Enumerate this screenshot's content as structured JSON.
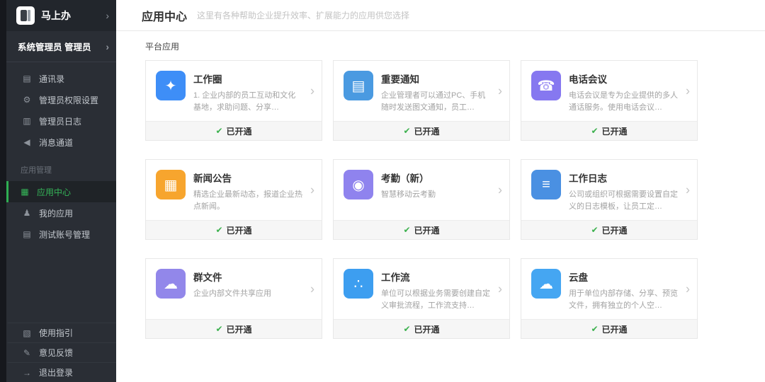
{
  "icons": {
    "chevron": "›",
    "check": "✔"
  },
  "sidebar": {
    "logo_text": "马上办",
    "admin_label": "系统管理员 管理员",
    "menu": [
      {
        "label": "通讯录",
        "glyph": "▤"
      },
      {
        "label": "管理员权限设置",
        "glyph": "⚙"
      },
      {
        "label": "管理员日志",
        "glyph": "▥"
      },
      {
        "label": "消息通道",
        "glyph": "◀"
      }
    ],
    "section_label": "应用管理",
    "app_menu": [
      {
        "label": "应用中心",
        "glyph": "▦"
      },
      {
        "label": "我的应用",
        "glyph": "♟"
      },
      {
        "label": "测试账号管理",
        "glyph": "▤"
      }
    ],
    "footer_menu": [
      {
        "label": "使用指引",
        "glyph": "▧"
      },
      {
        "label": "意见反馈",
        "glyph": "✎"
      },
      {
        "label": "退出登录",
        "glyph": "→"
      }
    ]
  },
  "header": {
    "title": "应用中心",
    "subtitle": "这里有各种帮助企业提升效率、扩展能力的应用供您选择"
  },
  "main": {
    "section_title": "平台应用",
    "status_label": "已开通",
    "cards": [
      {
        "title": "工作圈",
        "desc": "1. 企业内部的员工互动和文化基地，求助问题、分享…",
        "icon_color": "#3e8ef7",
        "glyph": "✦"
      },
      {
        "title": "重要通知",
        "desc": "企业管理者可以通过PC、手机随时发送图文通知，员工…",
        "icon_color": "#4a9ae1",
        "glyph": "▤"
      },
      {
        "title": "电话会议",
        "desc": "电话会议是专为企业提供的多人通话服务。使用电话会议…",
        "icon_color": "#8678f0",
        "glyph": "☎"
      },
      {
        "title": "新闻公告",
        "desc": "精选企业最新动态，报道企业热点新闻。",
        "icon_color": "#f7a52e",
        "glyph": "▦"
      },
      {
        "title": "考勤（新）",
        "desc": "智慧移动云考勤",
        "icon_color": "#8f83ee",
        "glyph": "◉"
      },
      {
        "title": "工作日志",
        "desc": "公司或组织可根据需要设置自定义的日志模板，让员工定…",
        "icon_color": "#4a90e2",
        "glyph": "≡"
      },
      {
        "title": "群文件",
        "desc": "企业内部文件共享应用",
        "icon_color": "#9287ea",
        "glyph": "☁"
      },
      {
        "title": "工作流",
        "desc": "单位可以根据业务需要创建自定义审批流程，工作流支持…",
        "icon_color": "#3d9ef0",
        "glyph": "∴"
      },
      {
        "title": "云盘",
        "desc": "用于单位内部存储、分享、预览文件，拥有独立的个人空…",
        "icon_color": "#45a6f2",
        "glyph": "☁"
      }
    ]
  }
}
